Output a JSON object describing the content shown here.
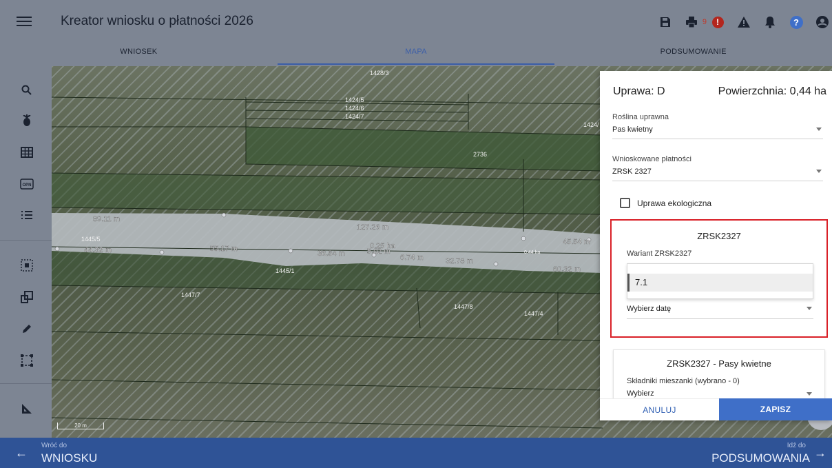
{
  "app": {
    "title": "Kreator wniosku o płatności 2026"
  },
  "topbar": {
    "icons": [
      "save-icon",
      "print-icon",
      "alert-icon",
      "warning-icon",
      "bell-icon",
      "help-icon",
      "account-icon"
    ],
    "alert_count": "9",
    "alert_symbol": "!",
    "help_symbol": "?"
  },
  "tabs": [
    {
      "label": "WNIOSEK",
      "active": false
    },
    {
      "label": "MAPA",
      "active": true
    },
    {
      "label": "PODSUMOWANIE",
      "active": false
    }
  ],
  "toolbar": {
    "tools": [
      "search-icon",
      "plant-icon",
      "grid-icon",
      "opn-icon",
      "list-icon",
      "select-point-icon",
      "copy-shape-icon",
      "pencil-icon",
      "select-area-icon",
      "measure-icon"
    ],
    "opn_text": "OPN"
  },
  "map": {
    "parcel_labels": [
      "1428/3",
      "1424/5",
      "1424/6",
      "1424/7",
      "1424/",
      "2736",
      "1445/5",
      "1445/1",
      "1447/7",
      "1447/8",
      "1447/4"
    ],
    "measurements": [
      "89.11 m",
      "127.26 m",
      "44.32 m",
      "55.17 m",
      "36.54 m",
      "0.25 ha",
      "5.02 m",
      "6.74 m",
      "32.78 m",
      "45.54 m",
      "60.32 m",
      "0.44 ha"
    ],
    "scale": "20 m"
  },
  "panel": {
    "crop_label": "Uprawa: D",
    "area_label": "Powierzchnia: 0,44 ha",
    "plant_label": "Roślina uprawna",
    "plant_value": "Pas kwietny",
    "payments_label": "Wnioskowane płatności",
    "payments_value": "ZRSK 2327",
    "eco_label": "Uprawa ekologiczna",
    "card_title": "ZRSK2327",
    "variant_label": "Wariant ZRSK2327",
    "variant_option": "7.1",
    "date_placeholder": "Wybierz datę",
    "card2_title": "ZRSK2327 - Pasy kwietne",
    "mix_label": "Składniki mieszanki (wybrano - 0)",
    "mix_value": "Wybierz",
    "cancel": "ANULUJ",
    "save": "ZAPISZ"
  },
  "bottombar": {
    "back_small": "Wróć do",
    "back_big": "WNIOSKU",
    "next_small": "Idź do",
    "next_big": "PODSUMOWANIA",
    "back_arrow": "←",
    "next_arrow": "→"
  },
  "colors": {
    "accent": "#3f6fc8",
    "highlight_border": "#d92027",
    "bottombar": "#2f5396"
  }
}
